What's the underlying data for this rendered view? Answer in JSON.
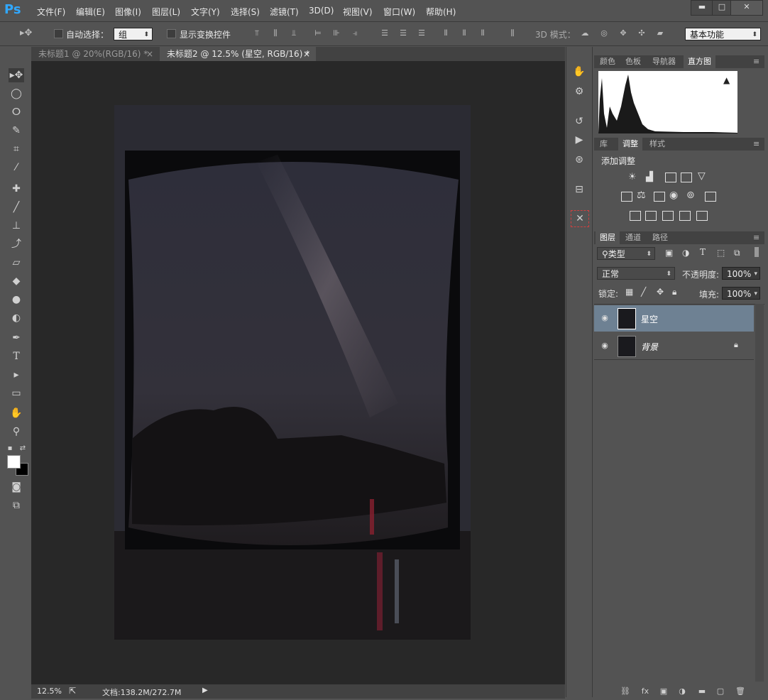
{
  "app": {
    "logo": "Ps"
  },
  "menu": [
    "文件(F)",
    "编辑(E)",
    "图像(I)",
    "图层(L)",
    "文字(Y)",
    "选择(S)",
    "滤镜(T)",
    "3D(D)",
    "视图(V)",
    "窗口(W)",
    "帮助(H)"
  ],
  "window_controls": {
    "minimize": "▬",
    "maximize": "□",
    "close": "✕"
  },
  "options": {
    "auto_select_label": "自动选择：",
    "auto_select_value": "组",
    "show_transform_label": "显示变换控件",
    "mode3d_label": "3D 模式：",
    "workspace": "基本功能"
  },
  "tabs": [
    {
      "label": "未标题1 @ 20%(RGB/16) *",
      "close": "×",
      "active": false
    },
    {
      "label": "未标题2 @ 12.5% (星空, RGB/16) *",
      "close": "×",
      "active": true
    }
  ],
  "status": {
    "zoom": "12.5%",
    "doc": "文档:138.2M/272.7M"
  },
  "panel_top": {
    "tabs": [
      "颜色",
      "色板",
      "导航器",
      "直方图"
    ],
    "active": "直方图",
    "warning": "▲"
  },
  "panel_mid": {
    "tabs": [
      "库",
      "调整",
      "样式"
    ],
    "active": "调整",
    "title": "添加调整"
  },
  "panel_layers": {
    "tabs": [
      "图层",
      "通道",
      "路径"
    ],
    "active": "图层",
    "filter": "类型",
    "blend_mode": "正常",
    "opacity_label": "不透明度:",
    "opacity_value": "100%",
    "lock_label": "锁定:",
    "fill_label": "填充:",
    "fill_value": "100%",
    "layers": [
      {
        "name": "星空",
        "selected": true,
        "locked": false
      },
      {
        "name": "背景",
        "selected": false,
        "locked": true
      }
    ]
  },
  "colors": {
    "selected_layer": "#6e8193",
    "canvas": "#282828",
    "ui": "#535353",
    "accent": "#31a8ff"
  }
}
